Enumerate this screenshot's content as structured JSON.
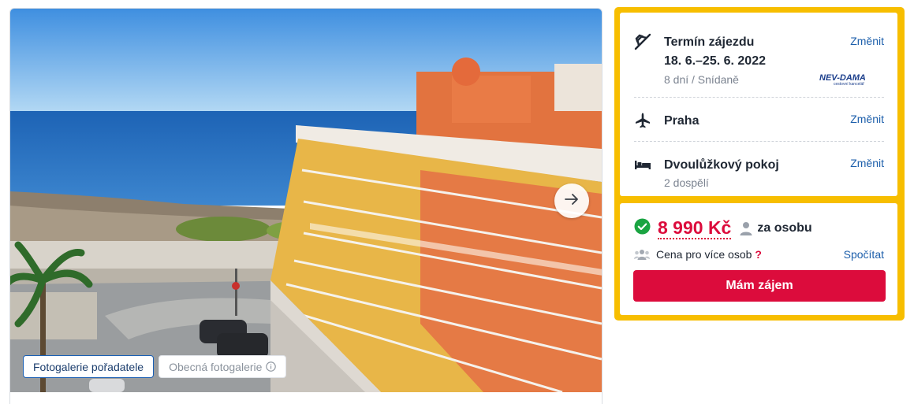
{
  "gallery": {
    "tabs": [
      {
        "label": "Fotogalerie pořadatele",
        "active": true
      },
      {
        "label": "Obecná fotogalerie",
        "active": false
      }
    ],
    "next_icon": "arrow-right-icon"
  },
  "trip": {
    "date_title": "Termín zájezdu",
    "date_range": "18. 6.–25. 6. 2022",
    "date_details": "8 dní / Snídaně",
    "date_change": "Změnit",
    "organizer_logo_text": "NEV-DAMA",
    "organizer_logo_sub": "cestovní kancelář",
    "departure_city": "Praha",
    "departure_change": "Změnit",
    "room_type": "Dvoulůžkový pokoj",
    "room_occupancy": "2 dospělí",
    "room_change": "Změnit"
  },
  "price": {
    "amount": "8 990 Kč",
    "per_person": "za osobu",
    "multi_label": "Cena pro více osob",
    "multi_help": "?",
    "calculate": "Spočítat",
    "cta": "Mám zájem"
  },
  "colors": {
    "accent": "#dc0c3c",
    "panel_border": "#f7be00",
    "link": "#1d5fab",
    "check": "#1aa442"
  }
}
